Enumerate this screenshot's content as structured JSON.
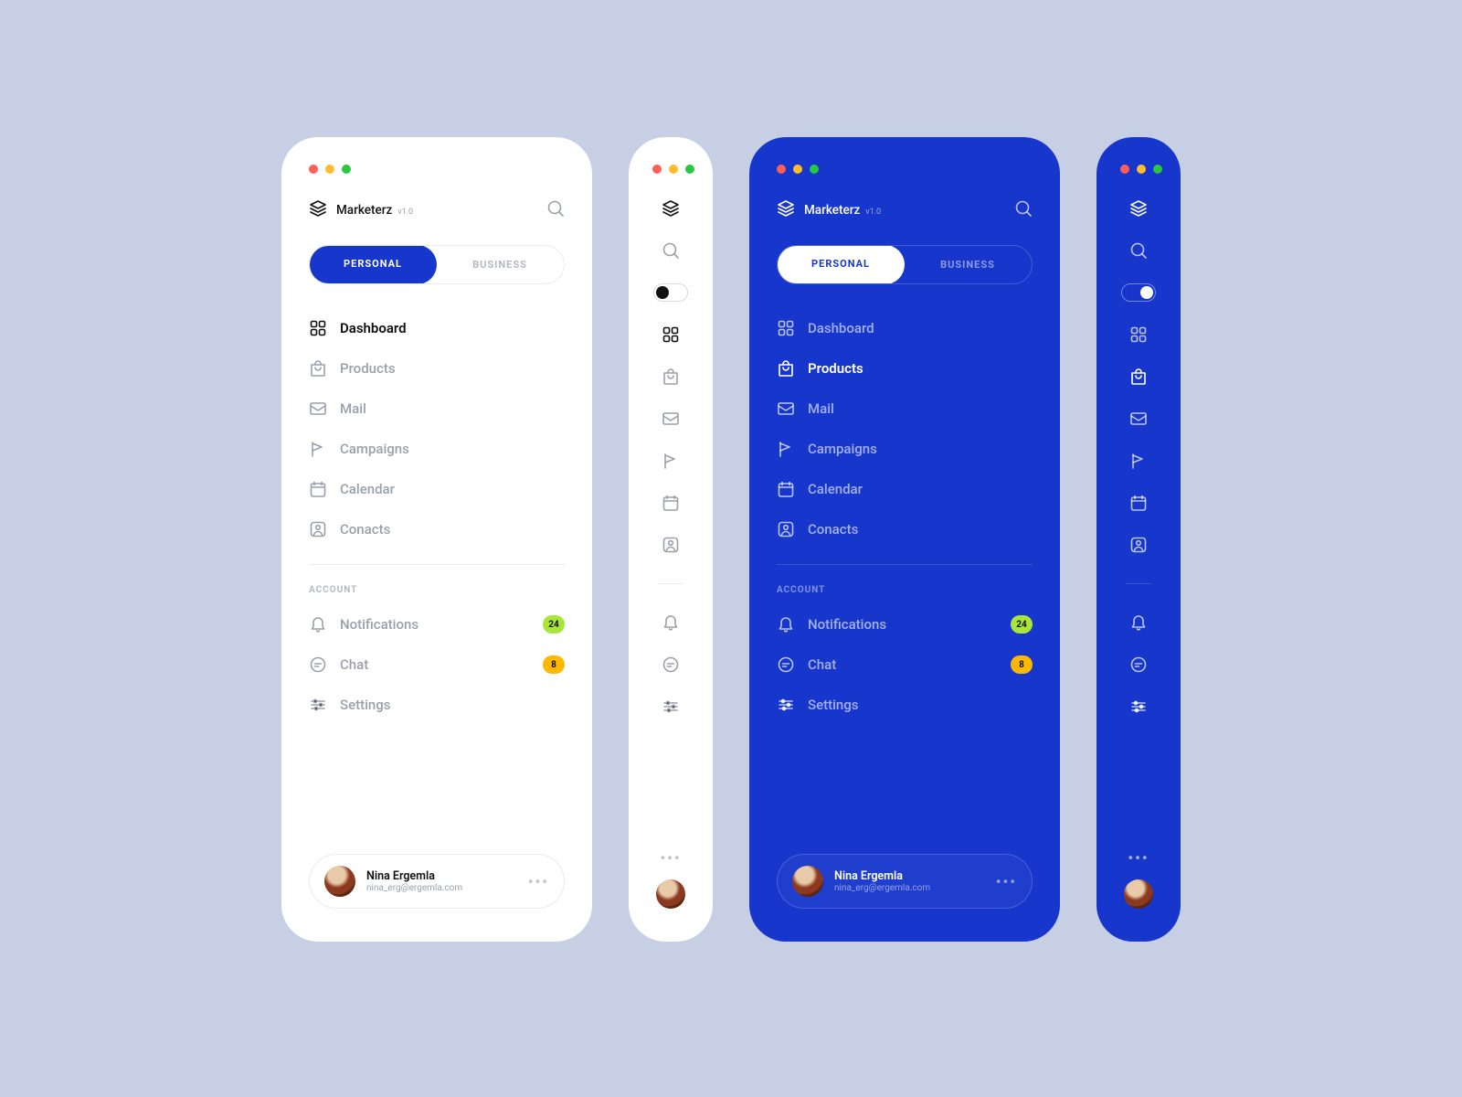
{
  "brand": {
    "name": "Marketerz",
    "version": "v1.0"
  },
  "tabs": {
    "personal": "PERSONAL",
    "business": "BUSINESS"
  },
  "nav": {
    "dashboard": "Dashboard",
    "products": "Products",
    "mail": "Mail",
    "campaigns": "Campaigns",
    "calendar": "Calendar",
    "contacts": "Conacts"
  },
  "section": {
    "account": "ACCOUNT"
  },
  "account_nav": {
    "notifications": "Notifications",
    "chat": "Chat",
    "settings": "Settings"
  },
  "badges": {
    "notifications": "24",
    "chat": "8"
  },
  "user": {
    "name": "Nina Ergemla",
    "email": "nina_erg@ergemla.com"
  },
  "colors": {
    "blue": "#1737CC",
    "lime": "#A8E63A",
    "gold": "#FFB800",
    "page_bg": "#C7CFE5"
  }
}
